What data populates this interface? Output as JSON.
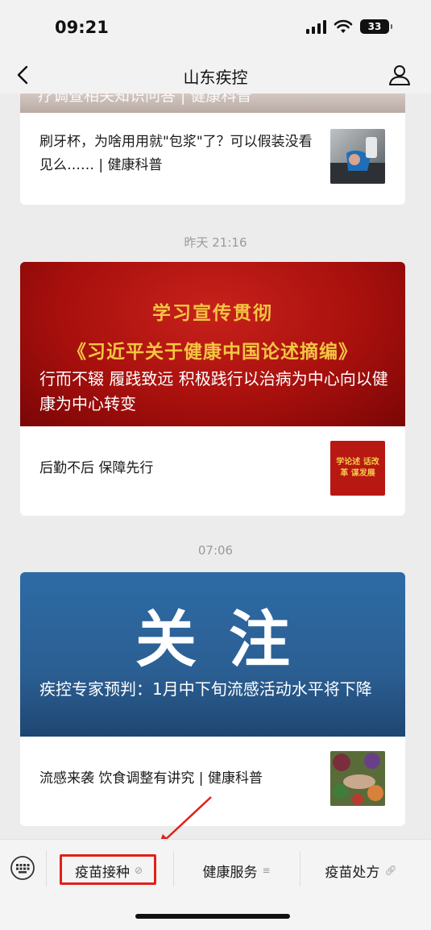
{
  "status_bar": {
    "time": "09:21",
    "battery": "33",
    "icons": [
      "signal-icon",
      "wifi-icon",
      "battery-icon"
    ]
  },
  "nav": {
    "title": "山东疾控",
    "back_icon": "chevron-left-icon",
    "profile_icon": "person-icon"
  },
  "feed": {
    "top_card": {
      "strip_text": "疗调查相关知识问答 | 健康科普",
      "item_title": "刷牙杯，为啥用用就\"包浆\"了？可以假装没看见么…… | 健康科普"
    },
    "groups": [
      {
        "timestamp": "昨天 21:16",
        "hero_line1": "学习宣传贯彻",
        "hero_line2": "《习近平关于健康中国论述摘编》",
        "hero_caption": "行而不辍 履践致远 积极践行以治病为中心向以健康为中心转变",
        "item_title": "后勤不后 保障先行",
        "thumb_text": "学论述 话改革 谋发展"
      },
      {
        "timestamp": "07:06",
        "hero_big": "关注",
        "hero_caption": "疾控专家预判：1月中下旬流感活动水平将下降",
        "item_title": "流感来袭 饮食调整有讲究 | 健康科普"
      }
    ]
  },
  "menu": {
    "items": [
      {
        "label": "疫苗接种",
        "icon": "mini-program-icon",
        "highlighted": true
      },
      {
        "label": "健康服务",
        "icon": "list-icon"
      },
      {
        "label": "疫苗处方",
        "icon": "link-icon"
      }
    ]
  },
  "colors": {
    "background": "#ececec",
    "hero_red": "#b3130f",
    "hero_gold": "#f4c542",
    "hero_blue": "#2b5f93",
    "highlight": "#e0211a"
  }
}
